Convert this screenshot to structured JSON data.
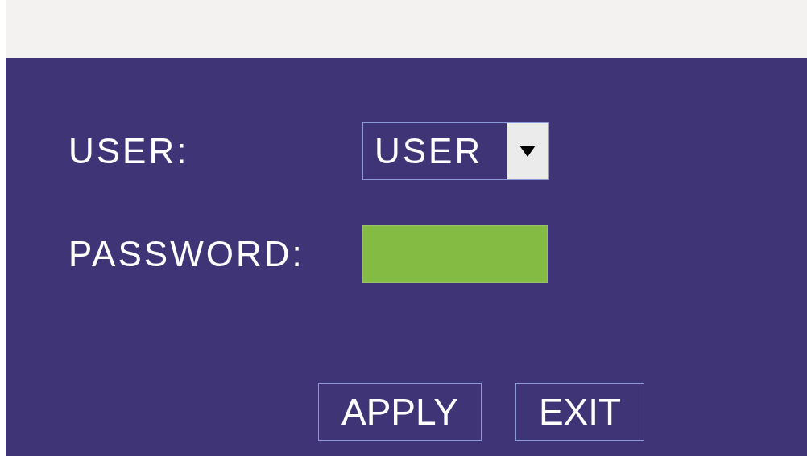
{
  "form": {
    "fields": [
      {
        "kind": "select",
        "label": "USER:",
        "value": "USER"
      },
      {
        "kind": "password",
        "label": "PASSWORD:"
      }
    ]
  },
  "buttons": [
    "APPLY",
    "EXIT"
  ]
}
